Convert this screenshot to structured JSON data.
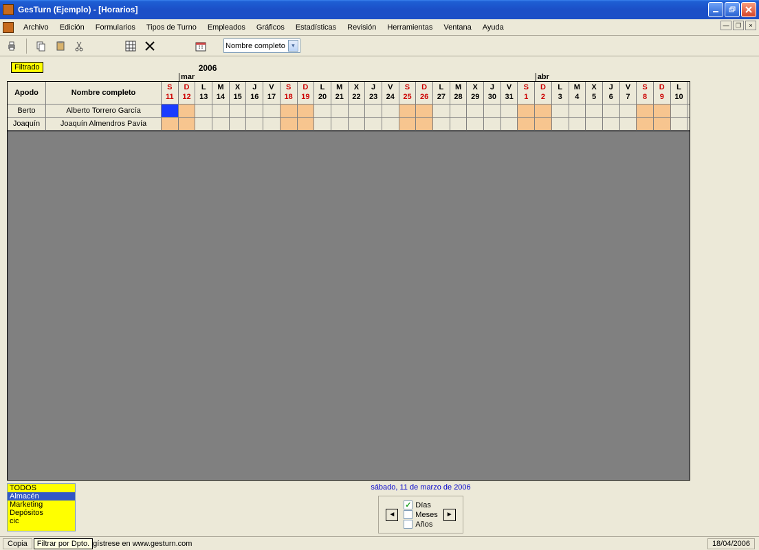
{
  "app": {
    "title": "GesTurn (Ejemplo) - [Horarios]"
  },
  "menu": {
    "items": [
      "Archivo",
      "Edición",
      "Formularios",
      "Tipos de Turno",
      "Empleados",
      "Gráficos",
      "Estadísticas",
      "Revisión",
      "Herramientas",
      "Ventana",
      "Ayuda"
    ]
  },
  "toolbar": {
    "name_selector": "Nombre completo"
  },
  "filter_chip": "Filtrado",
  "calendar": {
    "year": "2006",
    "months": [
      {
        "label": "mar",
        "span": 21
      },
      {
        "label": "abr",
        "span": 10
      }
    ],
    "columns": {
      "apodo": "Apodo",
      "nombre": "Nombre completo"
    },
    "days": [
      {
        "dow": "S",
        "num": "11",
        "weekend": true
      },
      {
        "dow": "D",
        "num": "12",
        "weekend": true
      },
      {
        "dow": "L",
        "num": "13",
        "weekend": false
      },
      {
        "dow": "M",
        "num": "14",
        "weekend": false
      },
      {
        "dow": "X",
        "num": "15",
        "weekend": false
      },
      {
        "dow": "J",
        "num": "16",
        "weekend": false
      },
      {
        "dow": "V",
        "num": "17",
        "weekend": false
      },
      {
        "dow": "S",
        "num": "18",
        "weekend": true
      },
      {
        "dow": "D",
        "num": "19",
        "weekend": true
      },
      {
        "dow": "L",
        "num": "20",
        "weekend": false
      },
      {
        "dow": "M",
        "num": "21",
        "weekend": false
      },
      {
        "dow": "X",
        "num": "22",
        "weekend": false
      },
      {
        "dow": "J",
        "num": "23",
        "weekend": false
      },
      {
        "dow": "V",
        "num": "24",
        "weekend": false
      },
      {
        "dow": "S",
        "num": "25",
        "weekend": true
      },
      {
        "dow": "D",
        "num": "26",
        "weekend": true
      },
      {
        "dow": "L",
        "num": "27",
        "weekend": false
      },
      {
        "dow": "M",
        "num": "28",
        "weekend": false
      },
      {
        "dow": "X",
        "num": "29",
        "weekend": false
      },
      {
        "dow": "J",
        "num": "30",
        "weekend": false
      },
      {
        "dow": "V",
        "num": "31",
        "weekend": false
      },
      {
        "dow": "S",
        "num": "1",
        "weekend": true
      },
      {
        "dow": "D",
        "num": "2",
        "weekend": true
      },
      {
        "dow": "L",
        "num": "3",
        "weekend": false
      },
      {
        "dow": "M",
        "num": "4",
        "weekend": false
      },
      {
        "dow": "X",
        "num": "5",
        "weekend": false
      },
      {
        "dow": "J",
        "num": "6",
        "weekend": false
      },
      {
        "dow": "V",
        "num": "7",
        "weekend": false
      },
      {
        "dow": "S",
        "num": "8",
        "weekend": true
      },
      {
        "dow": "D",
        "num": "9",
        "weekend": true
      },
      {
        "dow": "L",
        "num": "10",
        "weekend": false
      }
    ],
    "rows": [
      {
        "apodo": "Berto",
        "nombre": "Alberto Torrero García",
        "selected_day": 0
      },
      {
        "apodo": "Joaquín",
        "nombre": "Joaquín Almendros Pavía",
        "selected_day": -1
      }
    ]
  },
  "dept_list": {
    "items": [
      "TODOS",
      "Almacén",
      "Marketing",
      "Depósitos",
      "cic"
    ],
    "selected": 1,
    "tooltip": "Filtrar por Dpto."
  },
  "date_display": "sábado, 11 de marzo de 2006",
  "view_opts": {
    "dias": "Días",
    "meses": "Meses",
    "anos": "Años",
    "checked": "dias"
  },
  "status": {
    "left": "Copia",
    "center": "gístrese en www.gesturn.com",
    "date": "18/04/2006"
  }
}
